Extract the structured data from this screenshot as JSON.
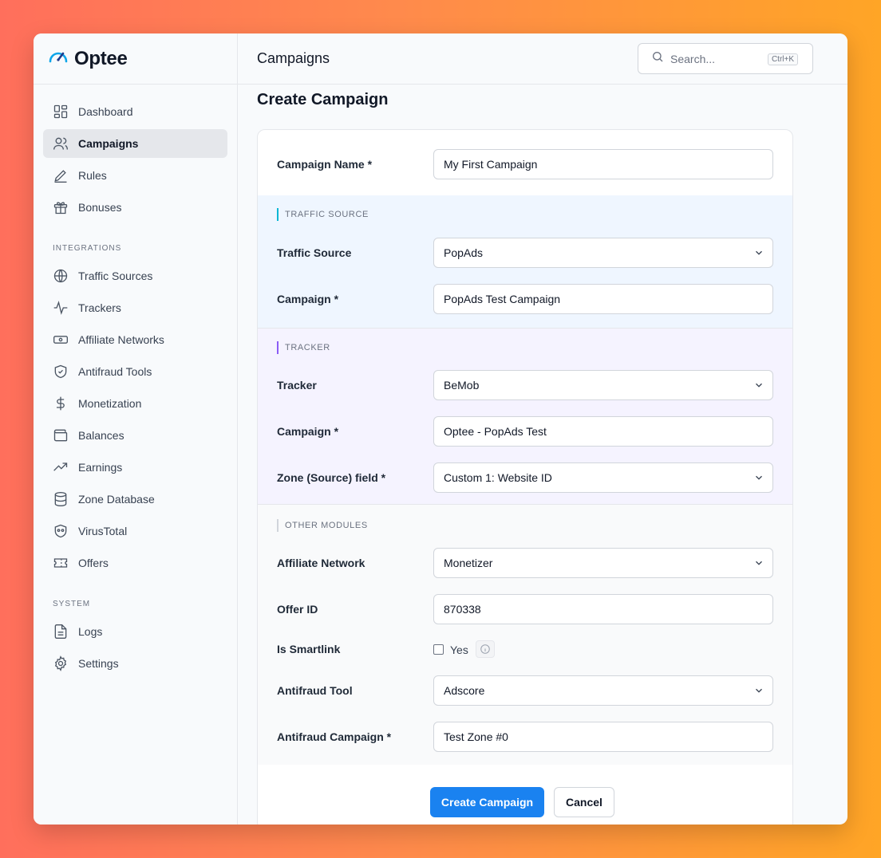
{
  "brand": {
    "name": "Optee"
  },
  "header": {
    "title": "Campaigns"
  },
  "search": {
    "placeholder": "Search...",
    "shortcut": "Ctrl+K"
  },
  "sidebar": {
    "main_items": [
      {
        "label": "Dashboard",
        "icon": "dashboard-icon"
      },
      {
        "label": "Campaigns",
        "icon": "users-icon",
        "active": true
      },
      {
        "label": "Rules",
        "icon": "pencil-icon"
      },
      {
        "label": "Bonuses",
        "icon": "gift-icon"
      }
    ],
    "integrations_label": "INTEGRATIONS",
    "integration_items": [
      {
        "label": "Traffic Sources",
        "icon": "globe-icon"
      },
      {
        "label": "Trackers",
        "icon": "activity-icon"
      },
      {
        "label": "Affiliate Networks",
        "icon": "banknote-icon"
      },
      {
        "label": "Antifraud Tools",
        "icon": "shield-check-icon"
      },
      {
        "label": "Monetization",
        "icon": "dollar-icon"
      },
      {
        "label": "Balances",
        "icon": "wallet-icon"
      },
      {
        "label": "Earnings",
        "icon": "trending-up-icon"
      },
      {
        "label": "Zone Database",
        "icon": "database-icon"
      },
      {
        "label": "VirusTotal",
        "icon": "mask-icon"
      },
      {
        "label": "Offers",
        "icon": "ticket-icon"
      }
    ],
    "system_label": "SYSTEM",
    "system_items": [
      {
        "label": "Logs",
        "icon": "file-text-icon"
      },
      {
        "label": "Settings",
        "icon": "gear-icon"
      }
    ]
  },
  "page": {
    "title": "Create Campaign"
  },
  "form": {
    "campaign_name": {
      "label": "Campaign Name *",
      "value": "My First Campaign"
    },
    "traffic_section": {
      "title": "TRAFFIC SOURCE",
      "color": "#06b6d4"
    },
    "traffic_source": {
      "label": "Traffic Source",
      "value": "PopAds"
    },
    "traffic_campaign": {
      "label": "Campaign *",
      "value": "PopAds Test Campaign"
    },
    "tracker_section": {
      "title": "TRACKER",
      "color": "#8b5cf6"
    },
    "tracker": {
      "label": "Tracker",
      "value": "BeMob"
    },
    "tracker_campaign": {
      "label": "Campaign *",
      "value": "Optee - PopAds Test"
    },
    "zone_field": {
      "label": "Zone (Source) field *",
      "value": "Custom 1: Website ID"
    },
    "other_section": {
      "title": "OTHER MODULES",
      "color": "#d1d5db"
    },
    "affiliate_network": {
      "label": "Affiliate Network",
      "value": "Monetizer"
    },
    "offer_id": {
      "label": "Offer ID",
      "value": "870338"
    },
    "is_smartlink": {
      "label": "Is Smartlink",
      "option": "Yes",
      "checked": false
    },
    "antifraud_tool": {
      "label": "Antifraud Tool",
      "value": "Adscore"
    },
    "antifraud_campaign": {
      "label": "Antifraud Campaign *",
      "value": "Test Zone #0"
    },
    "submit_label": "Create Campaign",
    "cancel_label": "Cancel"
  },
  "colors": {
    "primary": "#1a82f0",
    "active_nav_bg": "#e5e7eb"
  }
}
